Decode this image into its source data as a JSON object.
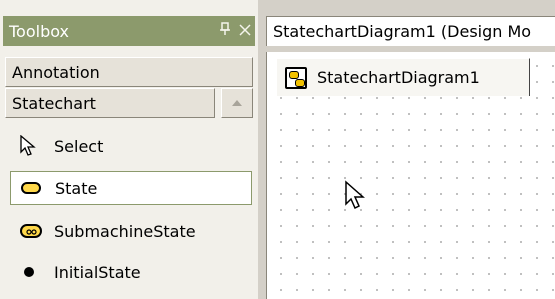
{
  "toolbox": {
    "title": "Toolbox",
    "pin_icon": "pin-icon",
    "close_icon": "close-icon",
    "sections": [
      {
        "label": "Annotation"
      },
      {
        "label": "Statechart"
      }
    ],
    "items": [
      {
        "label": "Select",
        "icon": "arrow-pointer-icon",
        "selected": false
      },
      {
        "label": "State",
        "icon": "state-icon",
        "selected": true
      },
      {
        "label": "SubmachineState",
        "icon": "submachine-state-icon",
        "selected": false
      },
      {
        "label": "InitialState",
        "icon": "initial-state-icon",
        "selected": false
      }
    ]
  },
  "document": {
    "title": "StatechartDiagram1 (Design Mo",
    "tab_label": "StatechartDiagram1",
    "tab_icon": "statechart-diagram-icon"
  },
  "colors": {
    "toolbox_title_bg": "#8c9a6c",
    "state_fill": "#ffd84a",
    "selection_border": "#8c9a6c"
  }
}
